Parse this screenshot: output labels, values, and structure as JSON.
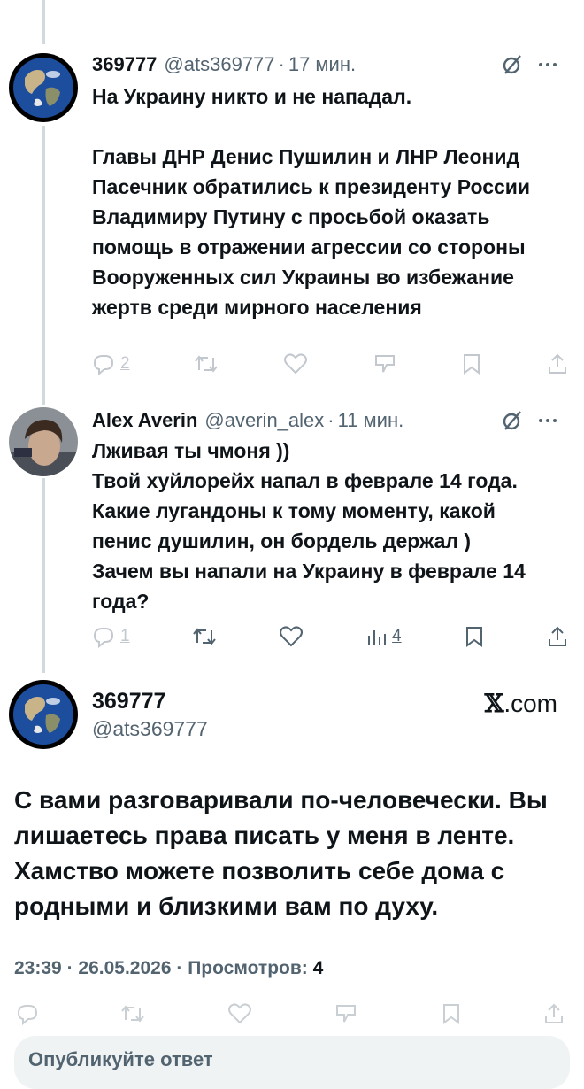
{
  "tweets": [
    {
      "name": "369777",
      "handle": "@ats369777",
      "separator": "·",
      "time": "17 мин.",
      "text": "На Украину никто и не нападал.\n\nГлавы ДНР Денис Пушилин и ЛНР Леонид Пасечник обратились к президенту России Владимиру Путину с просьбой оказать помощь в отражении агрессии со стороны Вооруженных сил Украины во избежание жертв среди мирного населения",
      "reply_count": "2"
    },
    {
      "name": "Alex Averin",
      "handle": "@averin_alex",
      "separator": "·",
      "time": "11 мин.",
      "text": "Лживая ты чмоня ))\nТвой хуйлорейх напал в феврале 14 года. Какие лугандоны к тому моменту, какой пенис душилин, он бордель держал )\nЗачем вы напали на Украину в феврале 14 года?",
      "reply_count": "1",
      "views_count": "4"
    }
  ],
  "main_tweet": {
    "name": "369777",
    "handle": "@ats369777",
    "brand_x": "𝕏",
    "brand_suffix": ".com",
    "text": "С вами разговаривали по-человечески. Вы лишаетесь права писать у меня в ленте. Хамство можете позволить себе дома с родными и близкими вам по духу.",
    "time": "23:39",
    "separator": "·",
    "date": "26.05.2026",
    "views_label": "Просмотров:",
    "views_count": "4"
  },
  "reply_placeholder": "Опубликуйте ответ",
  "icons": [
    "reply-icon",
    "retweet-icon",
    "like-icon",
    "views-icon",
    "bookmark-icon",
    "share-icon",
    "grok-icon",
    "more-icon"
  ],
  "colors": {
    "text": "#0f1419",
    "secondary": "#536471",
    "thread_line": "#cfd9de",
    "input_bg": "#eff3f4"
  }
}
